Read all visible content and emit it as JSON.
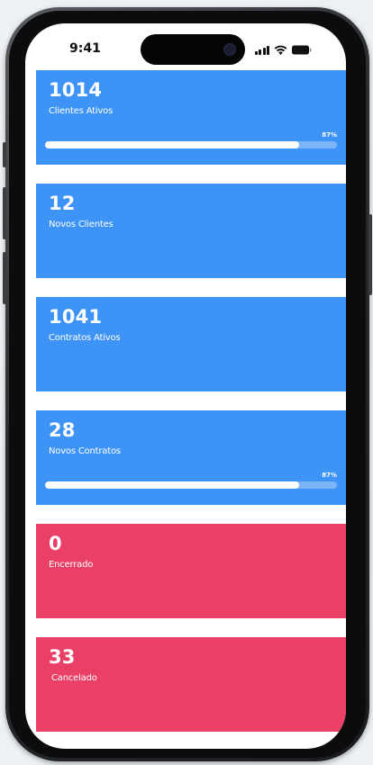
{
  "status_bar": {
    "time": "9:41"
  },
  "cards": [
    {
      "value": "1014",
      "label": "Clientes Ativos",
      "color": "#3e93f7",
      "progress_label": "87%",
      "progress": 0.87
    },
    {
      "value": "12",
      "label": "Novos Clientes",
      "color": "#3e93f7"
    },
    {
      "value": "1041",
      "label": "Contratos Ativos",
      "color": "#3e93f7"
    },
    {
      "value": "28",
      "label": "Novos Contratos",
      "color": "#3e93f7",
      "progress_label": "87%",
      "progress": 0.87
    },
    {
      "value": "0",
      "label": "Encerrado",
      "color": "#ea3f67"
    },
    {
      "value": "33",
      "label": "Cancelado",
      "color": "#ea3f67"
    }
  ],
  "icons": {
    "signal": "cellular-signal-icon",
    "wifi": "wifi-icon",
    "battery": "battery-icon"
  }
}
